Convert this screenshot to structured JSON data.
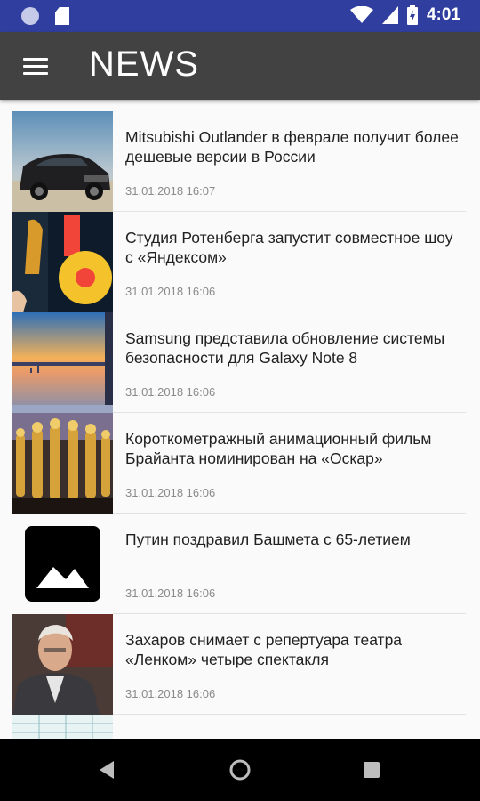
{
  "status_bar": {
    "time": "4:01"
  },
  "app_bar": {
    "title": "NEWS"
  },
  "news": [
    {
      "title": "Mitsubishi Outlander в феврале получит более дешевые версии в России",
      "date": "31.01.2018 16:07",
      "thumb": "car-photo"
    },
    {
      "title": "Студия Ротенберга запустит совместное шоу с «Яндексом»",
      "date": "31.01.2018 16:06",
      "thumb": "studio-logo-photo"
    },
    {
      "title": "Samsung представила обновление системы безопасности для Galaxy Note 8",
      "date": "31.01.2018 16:06",
      "thumb": "phone-screen-photo"
    },
    {
      "title": "Короткометражный анимационный фильм Брайанта номинирован на «Оскар»",
      "date": "31.01.2018 16:06",
      "thumb": "oscar-statues-photo"
    },
    {
      "title": "Путин поздравил Башмета с 65-летием",
      "date": "31.01.2018 16:06",
      "thumb": "image-placeholder-icon"
    },
    {
      "title": "Захаров снимает с репертуара театра «Ленком» четыре спектакля",
      "date": "31.01.2018 16:06",
      "thumb": "person-photo"
    },
    {
      "title": "",
      "date": "",
      "thumb": "table-photo"
    }
  ],
  "colors": {
    "status_bar": "#303f9f",
    "app_bar": "#424242",
    "background": "#fafafa",
    "nav_bar": "#000000"
  }
}
